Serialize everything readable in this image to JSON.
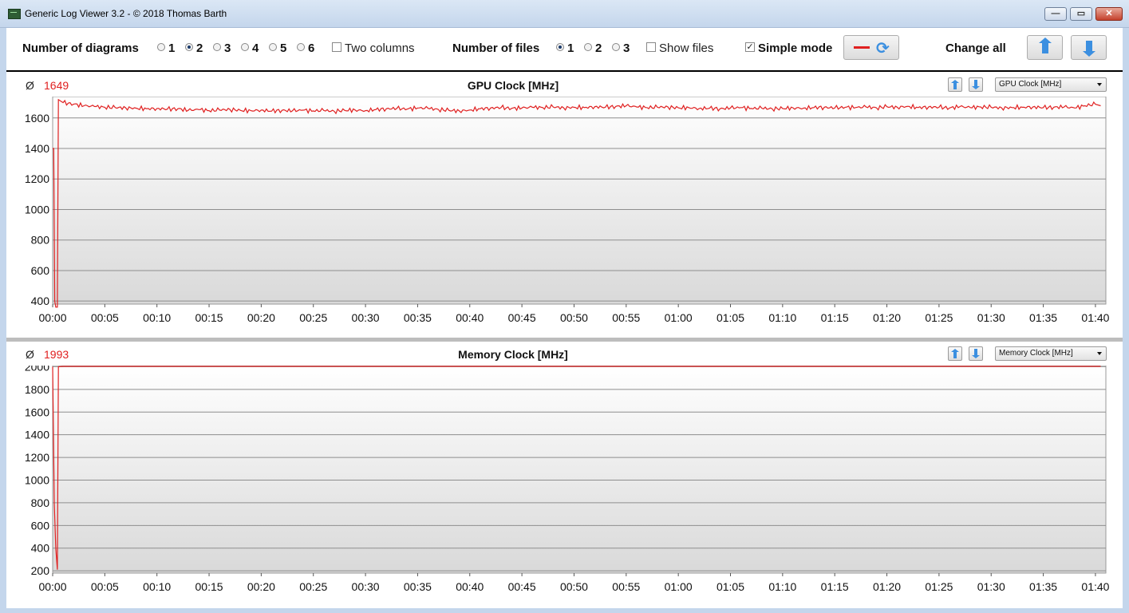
{
  "window": {
    "title": "Generic Log Viewer 3.2 - © 2018 Thomas Barth",
    "minimize_glyph": "—",
    "maximize_glyph": "▭",
    "close_glyph": "✕"
  },
  "toolbar": {
    "num_diagrams_label": "Number of diagrams",
    "diagram_options": [
      "1",
      "2",
      "3",
      "4",
      "5",
      "6"
    ],
    "diagram_selected": "2",
    "two_columns_label": "Two columns",
    "two_columns_checked": false,
    "num_files_label": "Number of files",
    "file_options": [
      "1",
      "2",
      "3"
    ],
    "file_selected": "1",
    "show_files_label": "Show files",
    "show_files_checked": false,
    "simple_mode_label": "Simple mode",
    "simple_mode_checked": true,
    "check_glyph": "✓",
    "refresh_glyph": "⟳",
    "change_all_label": "Change all",
    "line_color": "#e02020",
    "accent_color": "#3b8fe0"
  },
  "chart_data": [
    {
      "type": "line",
      "title": "GPU Clock [MHz]",
      "average_symbol": "Ø",
      "average": "1649",
      "selector_value": "GPU Clock [MHz]",
      "xlabel": "",
      "ylabel": "",
      "ylim": [
        380,
        1740
      ],
      "yticks": [
        400,
        600,
        800,
        1000,
        1200,
        1400,
        1600
      ],
      "xlim_minutes": [
        0,
        101
      ],
      "xtick_labels": [
        "00:00",
        "00:05",
        "00:10",
        "00:15",
        "00:20",
        "00:25",
        "00:30",
        "00:35",
        "00:40",
        "00:45",
        "00:50",
        "00:55",
        "01:00",
        "01:05",
        "01:10",
        "01:15",
        "01:20",
        "01:25",
        "01:30",
        "01:35",
        "01:40"
      ],
      "grid": true,
      "series": [
        {
          "color": "#e02020",
          "x_minutes": [
            0.0,
            0.1,
            0.2,
            0.3,
            0.45,
            0.55,
            1,
            2,
            3,
            4,
            5,
            6,
            7,
            8,
            9,
            10,
            11,
            12,
            13,
            14,
            15,
            16,
            17,
            18,
            19,
            20,
            21,
            22,
            23,
            24,
            25,
            26,
            27,
            28,
            29,
            30,
            31,
            32,
            33,
            34,
            35,
            36,
            37,
            38,
            39,
            40,
            41,
            42,
            43,
            44,
            45,
            46,
            47,
            48,
            49,
            50,
            51,
            52,
            53,
            54,
            55,
            56,
            57,
            58,
            59,
            60,
            61,
            62,
            63,
            64,
            65,
            66,
            67,
            68,
            69,
            70,
            71,
            72,
            73,
            74,
            75,
            76,
            77,
            78,
            79,
            80,
            81,
            82,
            83,
            84,
            85,
            86,
            87,
            88,
            89,
            90,
            91,
            92,
            93,
            94,
            95,
            96,
            97,
            98,
            99,
            100,
            100.5
          ],
          "values": [
            1400,
            1400,
            400,
            360,
            360,
            1720,
            1700,
            1690,
            1680,
            1675,
            1670,
            1668,
            1666,
            1664,
            1660,
            1662,
            1658,
            1660,
            1650,
            1655,
            1648,
            1652,
            1656,
            1650,
            1648,
            1652,
            1645,
            1650,
            1647,
            1651,
            1646,
            1649,
            1644,
            1650,
            1652,
            1648,
            1655,
            1660,
            1662,
            1658,
            1665,
            1663,
            1655,
            1650,
            1646,
            1652,
            1660,
            1665,
            1668,
            1662,
            1665,
            1670,
            1668,
            1672,
            1666,
            1670,
            1668,
            1674,
            1670,
            1675,
            1680,
            1672,
            1668,
            1670,
            1672,
            1666,
            1668,
            1662,
            1664,
            1660,
            1665,
            1668,
            1662,
            1664,
            1660,
            1662,
            1666,
            1664,
            1668,
            1670,
            1665,
            1670,
            1668,
            1672,
            1666,
            1674,
            1670,
            1676,
            1668,
            1672,
            1670,
            1665,
            1674,
            1668,
            1672,
            1670,
            1666,
            1668,
            1670,
            1672,
            1668,
            1670,
            1672,
            1665,
            1680,
            1690,
            1680
          ]
        }
      ]
    },
    {
      "type": "line",
      "title": "Memory Clock [MHz]",
      "average_symbol": "Ø",
      "average": "1993",
      "selector_value": "Memory Clock [MHz]",
      "xlabel": "",
      "ylabel": "",
      "ylim": [
        180,
        2010
      ],
      "yticks": [
        200,
        400,
        600,
        800,
        1000,
        1200,
        1400,
        1600,
        1800,
        2000
      ],
      "xlim_minutes": [
        0,
        101
      ],
      "xtick_labels": [
        "00:00",
        "00:05",
        "00:10",
        "00:15",
        "00:20",
        "00:25",
        "00:30",
        "00:35",
        "00:40",
        "00:45",
        "00:50",
        "00:55",
        "01:00",
        "01:05",
        "01:10",
        "01:15",
        "01:20",
        "01:25",
        "01:30",
        "01:35",
        "01:40"
      ],
      "grid": true,
      "series": [
        {
          "color": "#e02020",
          "x_minutes": [
            0.0,
            0.15,
            0.3,
            0.45,
            0.55,
            1,
            10,
            20,
            30,
            40,
            50,
            60,
            70,
            80,
            90,
            100,
            100.5
          ],
          "values": [
            2000,
            800,
            400,
            210,
            2000,
            2003,
            2003,
            2003,
            2003,
            2003,
            2003,
            2003,
            2003,
            2003,
            2003,
            2003,
            2003
          ]
        }
      ]
    }
  ]
}
